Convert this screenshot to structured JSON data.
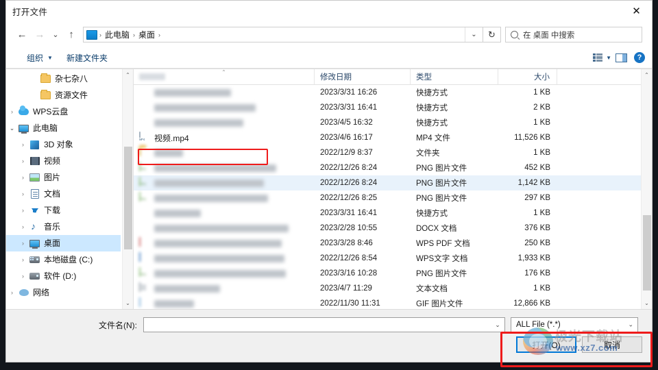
{
  "window": {
    "title": "打开文件",
    "close_label": "✕"
  },
  "nav": {
    "back_icon": "←",
    "forward_icon": "→",
    "recent_icon": "⌄",
    "up_icon": "↑",
    "refresh_icon": "↻",
    "dropdown_icon": "⌄"
  },
  "breadcrumb": {
    "icon": "desktop-icon",
    "separator": "›",
    "items": [
      "此电脑",
      "桌面"
    ]
  },
  "search": {
    "placeholder": "在 桌面 中搜索",
    "icon": "search-icon"
  },
  "toolbar": {
    "organize_label": "组织",
    "organize_caret": "▼",
    "new_folder_label": "新建文件夹",
    "view_caret": "▼",
    "help_label": "?"
  },
  "sidebar": {
    "items": [
      {
        "label": "杂七杂八",
        "icon": "folder-icon",
        "chevron": "",
        "indent": 2,
        "selected": false
      },
      {
        "label": "资源文件",
        "icon": "folder-icon",
        "chevron": "",
        "indent": 2,
        "selected": false
      },
      {
        "label": "WPS云盘",
        "icon": "cloud-icon",
        "chevron": "›",
        "indent": 0,
        "selected": false
      },
      {
        "label": "此电脑",
        "icon": "computer-icon",
        "chevron": "⌄",
        "indent": 0,
        "selected": false
      },
      {
        "label": "3D 对象",
        "icon": "cube-icon",
        "chevron": "›",
        "indent": 1,
        "selected": false
      },
      {
        "label": "视频",
        "icon": "video-icon",
        "chevron": "›",
        "indent": 1,
        "selected": false
      },
      {
        "label": "图片",
        "icon": "pictures-icon",
        "chevron": "›",
        "indent": 1,
        "selected": false
      },
      {
        "label": "文档",
        "icon": "documents-icon",
        "chevron": "›",
        "indent": 1,
        "selected": false
      },
      {
        "label": "下载",
        "icon": "downloads-icon",
        "chevron": "›",
        "indent": 1,
        "selected": false
      },
      {
        "label": "音乐",
        "icon": "music-icon",
        "chevron": "›",
        "indent": 1,
        "selected": false
      },
      {
        "label": "桌面",
        "icon": "desktop-icon",
        "chevron": "›",
        "indent": 1,
        "selected": true
      },
      {
        "label": "本地磁盘 (C:)",
        "icon": "disk-windows-icon",
        "chevron": "›",
        "indent": 1,
        "selected": false
      },
      {
        "label": "软件 (D:)",
        "icon": "disk-icon",
        "chevron": "›",
        "indent": 1,
        "selected": false
      },
      {
        "label": "网络",
        "icon": "network-icon",
        "chevron": "›",
        "indent": 0,
        "selected": false
      }
    ],
    "scroll_up_icon": "⌃",
    "scroll_down_icon": "⌄"
  },
  "filelist": {
    "columns": {
      "name": "",
      "date": "修改日期",
      "type": "类型",
      "size": "大小"
    },
    "sort_indicator": "⌃",
    "rows": [
      {
        "name": "",
        "blurred": true,
        "icon": "generic-file-icon",
        "date": "2023/3/31 16:26",
        "type": "快捷方式",
        "size": "1 KB",
        "selected": false,
        "highlighted": false,
        "namewidth": 112
      },
      {
        "name": "",
        "blurred": true,
        "icon": "generic-file-icon",
        "date": "2023/3/31 16:41",
        "type": "快捷方式",
        "size": "2 KB",
        "selected": false,
        "highlighted": false,
        "namewidth": 148
      },
      {
        "name": "",
        "blurred": true,
        "icon": "generic-file-icon",
        "date": "2023/4/5 16:32",
        "type": "快捷方式",
        "size": "1 KB",
        "selected": false,
        "highlighted": false,
        "namewidth": 130
      },
      {
        "name": "视频.mp4",
        "blurred": false,
        "icon": "mp4-file-icon",
        "date": "2023/4/6 16:17",
        "type": "MP4 文件",
        "size": "11,526 KB",
        "selected": false,
        "highlighted": true,
        "namewidth": 0
      },
      {
        "name": "",
        "blurred": true,
        "icon": "folder-icon",
        "date": "2022/12/9 8:37",
        "type": "文件夹",
        "size": "1 KB",
        "selected": false,
        "highlighted": false,
        "namewidth": 42
      },
      {
        "name": "",
        "blurred": true,
        "icon": "png-file-icon",
        "date": "2022/12/26 8:24",
        "type": "PNG 图片文件",
        "size": "452 KB",
        "selected": false,
        "highlighted": false,
        "namewidth": 178
      },
      {
        "name": "",
        "blurred": true,
        "icon": "png-file-icon",
        "date": "2022/12/26 8:24",
        "type": "PNG 图片文件",
        "size": "1,142 KB",
        "selected": true,
        "highlighted": false,
        "namewidth": 160
      },
      {
        "name": "",
        "blurred": true,
        "icon": "png-file-icon",
        "date": "2022/12/26 8:25",
        "type": "PNG 图片文件",
        "size": "297 KB",
        "selected": false,
        "highlighted": false,
        "namewidth": 166
      },
      {
        "name": "",
        "blurred": true,
        "icon": "shortcut-icon",
        "date": "2023/3/31 16:41",
        "type": "快捷方式",
        "size": "1 KB",
        "selected": false,
        "highlighted": false,
        "namewidth": 68
      },
      {
        "name": "",
        "blurred": true,
        "icon": "docx-file-icon",
        "date": "2023/2/28 10:55",
        "type": "DOCX 文档",
        "size": "376 KB",
        "selected": false,
        "highlighted": false,
        "namewidth": 196
      },
      {
        "name": "",
        "blurred": true,
        "icon": "pdf-file-icon",
        "date": "2023/3/28 8:46",
        "type": "WPS PDF 文档",
        "size": "250 KB",
        "selected": false,
        "highlighted": false,
        "namewidth": 186
      },
      {
        "name": "",
        "blurred": true,
        "icon": "wps-file-icon",
        "date": "2022/12/26 8:54",
        "type": "WPS文字 文档",
        "size": "1,933 KB",
        "selected": false,
        "highlighted": false,
        "namewidth": 190
      },
      {
        "name": "",
        "blurred": true,
        "icon": "png-file-icon",
        "date": "2023/3/16 10:28",
        "type": "PNG 图片文件",
        "size": "176 KB",
        "selected": false,
        "highlighted": false,
        "namewidth": 192
      },
      {
        "name": "",
        "blurred": true,
        "icon": "txt-file-icon",
        "date": "2023/4/7 11:29",
        "type": "文本文档",
        "size": "1 KB",
        "selected": false,
        "highlighted": false,
        "namewidth": 96
      },
      {
        "name": "",
        "blurred": true,
        "icon": "gif-file-icon",
        "date": "2022/11/30 11:31",
        "type": "GIF 图片文件",
        "size": "12,866 KB",
        "selected": false,
        "highlighted": false,
        "namewidth": 58
      }
    ],
    "scroll_up_icon": "⌃",
    "scroll_down_icon": "⌄"
  },
  "footer": {
    "filename_label": "文件名(N):",
    "filename_value": "",
    "filename_placeholder": "",
    "filter_value": "ALL File (*.*)",
    "filter_caret": "⌄",
    "open_label": "打开(O)",
    "cancel_label": "取消"
  },
  "watermark": {
    "brand": "极光下载站",
    "url": "www.xz7.com"
  },
  "annotation": {
    "color": "#ee1b1b"
  }
}
